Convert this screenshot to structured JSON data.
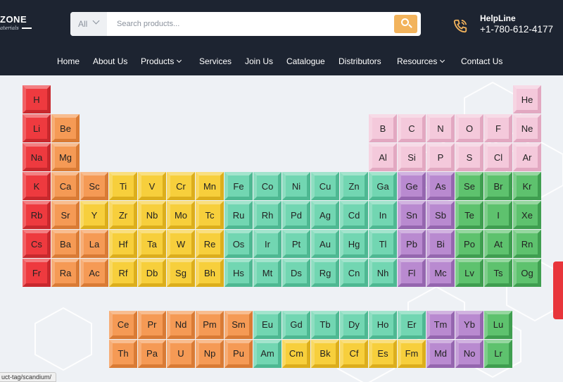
{
  "header": {
    "logo_line1": "ZONE",
    "logo_line2": "aterials",
    "search": {
      "category": "All",
      "placeholder": "Search products..."
    },
    "helpline_label": "HelpLine",
    "helpline_number": "+1-780-612-4177"
  },
  "nav": [
    {
      "label": "Home",
      "dropdown": false
    },
    {
      "label": "About Us",
      "dropdown": false
    },
    {
      "label": "Products",
      "dropdown": true
    },
    {
      "label": "Services",
      "dropdown": false
    },
    {
      "label": "Join Us",
      "dropdown": false
    },
    {
      "label": "Catalogue",
      "dropdown": false
    },
    {
      "label": "Distributors",
      "dropdown": false
    },
    {
      "label": "Resources",
      "dropdown": true
    },
    {
      "label": "Contact Us",
      "dropdown": false
    }
  ],
  "status_url": "uct-tag/scandium/",
  "colors": {
    "header_bg": "#1d2431",
    "search_button": "#f2b35c",
    "accent_tab": "#e8353b"
  },
  "category_colors": {
    "alkali": {
      "face": "#ee3a3f",
      "border": "#c8282d"
    },
    "alkaline": {
      "face": "#f59a55",
      "border": "#d97b35"
    },
    "transition": {
      "face": "#f7cf3c",
      "border": "#dcae1c"
    },
    "post": {
      "face": "#72d6b2",
      "border": "#4eb892"
    },
    "metalloid": {
      "face": "#b98ad0",
      "border": "#9566af"
    },
    "nonmetal": {
      "face": "#5ec26e",
      "border": "#3f9e50"
    },
    "pink": {
      "face": "#f4c9db",
      "border": "#e2a8c1"
    },
    "lanthanide": {
      "face": "#f59a55",
      "border": "#d97b35"
    },
    "actinide": {
      "face": "#f59a55",
      "border": "#d97b35"
    }
  },
  "periodic_table": [
    [
      "H",
      1,
      1,
      "alkali"
    ],
    [
      "He",
      18,
      1,
      "pink"
    ],
    [
      "Li",
      1,
      2,
      "alkali"
    ],
    [
      "Be",
      2,
      2,
      "alkaline"
    ],
    [
      "B",
      13,
      2,
      "pink"
    ],
    [
      "C",
      14,
      2,
      "pink"
    ],
    [
      "N",
      15,
      2,
      "pink"
    ],
    [
      "O",
      16,
      2,
      "pink"
    ],
    [
      "F",
      17,
      2,
      "pink"
    ],
    [
      "Ne",
      18,
      2,
      "pink"
    ],
    [
      "Na",
      1,
      3,
      "alkali"
    ],
    [
      "Mg",
      2,
      3,
      "alkaline"
    ],
    [
      "Al",
      13,
      3,
      "pink"
    ],
    [
      "Si",
      14,
      3,
      "pink"
    ],
    [
      "P",
      15,
      3,
      "pink"
    ],
    [
      "S",
      16,
      3,
      "pink"
    ],
    [
      "Cl",
      17,
      3,
      "pink"
    ],
    [
      "Ar",
      18,
      3,
      "pink"
    ],
    [
      "K",
      1,
      4,
      "alkali"
    ],
    [
      "Ca",
      2,
      4,
      "alkaline"
    ],
    [
      "Sc",
      3,
      4,
      "alkaline"
    ],
    [
      "Ti",
      4,
      4,
      "transition"
    ],
    [
      "V",
      5,
      4,
      "transition"
    ],
    [
      "Cr",
      6,
      4,
      "transition"
    ],
    [
      "Mn",
      7,
      4,
      "transition"
    ],
    [
      "Fe",
      8,
      4,
      "post"
    ],
    [
      "Co",
      9,
      4,
      "post"
    ],
    [
      "Ni",
      10,
      4,
      "post"
    ],
    [
      "Cu",
      11,
      4,
      "post"
    ],
    [
      "Zn",
      12,
      4,
      "post"
    ],
    [
      "Ga",
      13,
      4,
      "post"
    ],
    [
      "Ge",
      14,
      4,
      "metalloid"
    ],
    [
      "As",
      15,
      4,
      "metalloid"
    ],
    [
      "Se",
      16,
      4,
      "nonmetal"
    ],
    [
      "Br",
      17,
      4,
      "nonmetal"
    ],
    [
      "Kr",
      18,
      4,
      "nonmetal"
    ],
    [
      "Rb",
      1,
      5,
      "alkali"
    ],
    [
      "Sr",
      2,
      5,
      "alkaline"
    ],
    [
      "Y",
      3,
      5,
      "transition"
    ],
    [
      "Zr",
      4,
      5,
      "transition"
    ],
    [
      "Nb",
      5,
      5,
      "transition"
    ],
    [
      "Mo",
      6,
      5,
      "transition"
    ],
    [
      "Tc",
      7,
      5,
      "transition"
    ],
    [
      "Ru",
      8,
      5,
      "post"
    ],
    [
      "Rh",
      9,
      5,
      "post"
    ],
    [
      "Pd",
      10,
      5,
      "post"
    ],
    [
      "Ag",
      11,
      5,
      "post"
    ],
    [
      "Cd",
      12,
      5,
      "post"
    ],
    [
      "In",
      13,
      5,
      "post"
    ],
    [
      "Sn",
      14,
      5,
      "metalloid"
    ],
    [
      "Sb",
      15,
      5,
      "metalloid"
    ],
    [
      "Te",
      16,
      5,
      "nonmetal"
    ],
    [
      "I",
      17,
      5,
      "nonmetal"
    ],
    [
      "Xe",
      18,
      5,
      "nonmetal"
    ],
    [
      "Cs",
      1,
      6,
      "alkali"
    ],
    [
      "Ba",
      2,
      6,
      "alkaline"
    ],
    [
      "La",
      3,
      6,
      "alkaline"
    ],
    [
      "Hf",
      4,
      6,
      "transition"
    ],
    [
      "Ta",
      5,
      6,
      "transition"
    ],
    [
      "W",
      6,
      6,
      "transition"
    ],
    [
      "Re",
      7,
      6,
      "transition"
    ],
    [
      "Os",
      8,
      6,
      "post"
    ],
    [
      "Ir",
      9,
      6,
      "post"
    ],
    [
      "Pt",
      10,
      6,
      "post"
    ],
    [
      "Au",
      11,
      6,
      "post"
    ],
    [
      "Hg",
      12,
      6,
      "post"
    ],
    [
      "Tl",
      13,
      6,
      "post"
    ],
    [
      "Pb",
      14,
      6,
      "metalloid"
    ],
    [
      "Bi",
      15,
      6,
      "metalloid"
    ],
    [
      "Po",
      16,
      6,
      "nonmetal"
    ],
    [
      "At",
      17,
      6,
      "nonmetal"
    ],
    [
      "Rn",
      18,
      6,
      "nonmetal"
    ],
    [
      "Fr",
      1,
      7,
      "alkali"
    ],
    [
      "Ra",
      2,
      7,
      "alkaline"
    ],
    [
      "Ac",
      3,
      7,
      "alkaline"
    ],
    [
      "Rf",
      4,
      7,
      "transition"
    ],
    [
      "Db",
      5,
      7,
      "transition"
    ],
    [
      "Sg",
      6,
      7,
      "transition"
    ],
    [
      "Bh",
      7,
      7,
      "transition"
    ],
    [
      "Hs",
      8,
      7,
      "post"
    ],
    [
      "Mt",
      9,
      7,
      "post"
    ],
    [
      "Ds",
      10,
      7,
      "post"
    ],
    [
      "Rg",
      11,
      7,
      "post"
    ],
    [
      "Cn",
      12,
      7,
      "post"
    ],
    [
      "Nh",
      13,
      7,
      "post"
    ],
    [
      "Fl",
      14,
      7,
      "metalloid"
    ],
    [
      "Mc",
      15,
      7,
      "metalloid"
    ],
    [
      "Lv",
      16,
      7,
      "nonmetal"
    ],
    [
      "Ts",
      17,
      7,
      "nonmetal"
    ],
    [
      "Og",
      18,
      7,
      "nonmetal"
    ],
    [
      "Ce",
      4,
      8.8,
      "alkaline"
    ],
    [
      "Pr",
      5,
      8.8,
      "alkaline"
    ],
    [
      "Nd",
      6,
      8.8,
      "alkaline"
    ],
    [
      "Pm",
      7,
      8.8,
      "alkaline"
    ],
    [
      "Sm",
      8,
      8.8,
      "alkaline"
    ],
    [
      "Eu",
      9,
      8.8,
      "post"
    ],
    [
      "Gd",
      10,
      8.8,
      "post"
    ],
    [
      "Tb",
      11,
      8.8,
      "post"
    ],
    [
      "Dy",
      12,
      8.8,
      "post"
    ],
    [
      "Ho",
      13,
      8.8,
      "post"
    ],
    [
      "Er",
      14,
      8.8,
      "post"
    ],
    [
      "Tm",
      15,
      8.8,
      "metalloid"
    ],
    [
      "Yb",
      16,
      8.8,
      "metalloid"
    ],
    [
      "Lu",
      17,
      8.8,
      "nonmetal"
    ],
    [
      "Th",
      4,
      9.8,
      "alkaline"
    ],
    [
      "Pa",
      5,
      9.8,
      "alkaline"
    ],
    [
      "U",
      6,
      9.8,
      "alkaline"
    ],
    [
      "Np",
      7,
      9.8,
      "alkaline"
    ],
    [
      "Pu",
      8,
      9.8,
      "alkaline"
    ],
    [
      "Am",
      9,
      9.8,
      "post"
    ],
    [
      "Cm",
      10,
      9.8,
      "transition"
    ],
    [
      "Bk",
      11,
      9.8,
      "transition"
    ],
    [
      "Cf",
      12,
      9.8,
      "transition"
    ],
    [
      "Es",
      13,
      9.8,
      "transition"
    ],
    [
      "Fm",
      14,
      9.8,
      "transition"
    ],
    [
      "Md",
      15,
      9.8,
      "metalloid"
    ],
    [
      "No",
      16,
      9.8,
      "metalloid"
    ],
    [
      "Lr",
      17,
      9.8,
      "nonmetal"
    ]
  ]
}
